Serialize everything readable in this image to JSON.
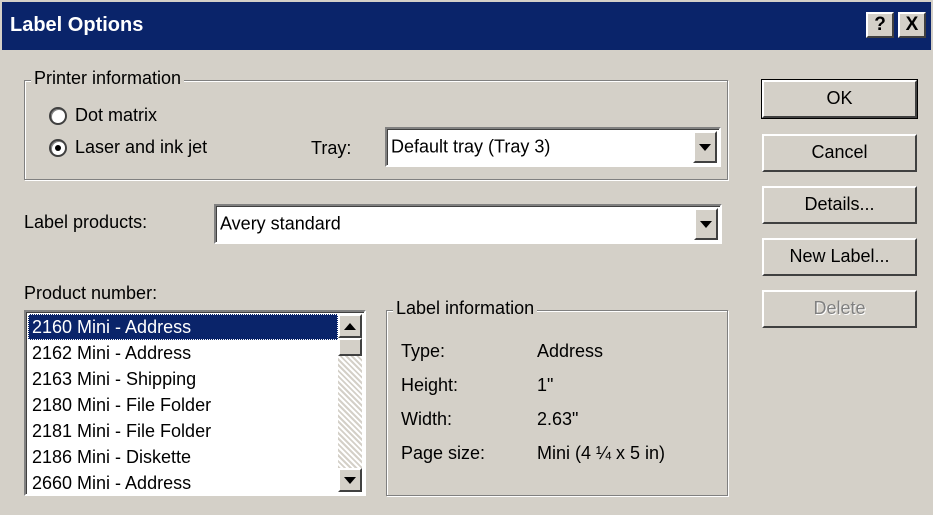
{
  "window": {
    "title": "Label Options",
    "help_label": "?",
    "close_label": "X"
  },
  "printer_info": {
    "legend": "Printer information",
    "dot_matrix_label": "Dot matrix",
    "laser_label": "Laser and ink jet",
    "selected": "laser",
    "tray_label": "Tray:",
    "tray_value": "Default tray (Tray 3)"
  },
  "label_products": {
    "label": "Label products:",
    "value": "Avery standard"
  },
  "product_number": {
    "label": "Product number:",
    "selected_index": 0,
    "items": [
      "2160 Mini - Address",
      "2162 Mini - Address",
      "2163 Mini - Shipping",
      "2180 Mini - File Folder",
      "2181 Mini - File Folder",
      "2186 Mini - Diskette",
      "2660 Mini - Address"
    ]
  },
  "label_info": {
    "legend": "Label information",
    "rows": [
      {
        "key": "Type:",
        "value": "Address"
      },
      {
        "key": "Height:",
        "value": "1\""
      },
      {
        "key": "Width:",
        "value": "2.63\""
      },
      {
        "key": "Page size:",
        "value": "Mini (4 ¼ x 5 in)"
      }
    ]
  },
  "buttons": {
    "ok": "OK",
    "cancel": "Cancel",
    "details": "Details...",
    "new_label": "New Label...",
    "delete": "Delete"
  },
  "colors": {
    "title_bar": "#0a246a",
    "face": "#d4d0c8",
    "selection": "#0a246a"
  }
}
